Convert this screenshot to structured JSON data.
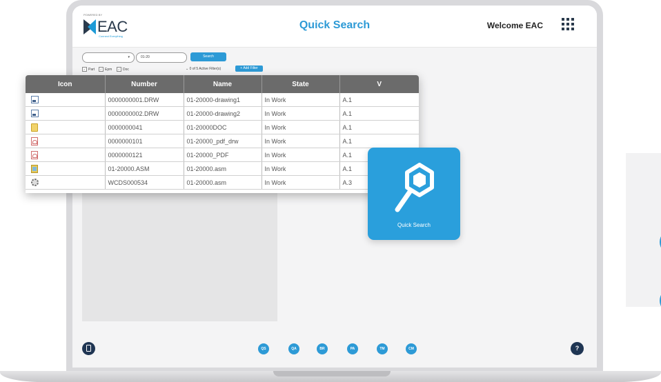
{
  "header": {
    "logo_text": "EAC",
    "logo_small": "POWERED BY",
    "logo_tagline": "Connect Everything",
    "title": "Quick Search",
    "welcome": "Welcome EAC",
    "menu_icon": "apps-grid-icon"
  },
  "search": {
    "select_value": "",
    "input_value": "01-20",
    "button_label": "Search",
    "filters": [
      {
        "label": "Part",
        "checked": true
      },
      {
        "label": "Epm",
        "checked": true
      },
      {
        "label": "Doc",
        "checked": true
      }
    ],
    "active_filters": "0 of 5 Active Filter(s)",
    "add_filter": "+ Add Filter"
  },
  "table": {
    "columns": [
      "Icon",
      "Number",
      "Name",
      "State",
      "V"
    ],
    "rows": [
      {
        "icon": "drawing-icon",
        "number": "0000000001.DRW",
        "name": "01-20000-drawing1",
        "state": "In Work",
        "version": "A.1"
      },
      {
        "icon": "drawing-icon",
        "number": "0000000002.DRW",
        "name": "01-20000-drawing2",
        "state": "In Work",
        "version": "A.1"
      },
      {
        "icon": "document-icon",
        "number": "0000000041",
        "name": "01-20000DOC",
        "state": "In Work",
        "version": "A.1"
      },
      {
        "icon": "pdf-icon",
        "number": "0000000101",
        "name": "01-20000_pdf_drw",
        "state": "In Work",
        "version": "A.1"
      },
      {
        "icon": "pdf-icon",
        "number": "0000000121",
        "name": "01-20000_PDF",
        "state": "In Work",
        "version": "A.1"
      },
      {
        "icon": "assembly-icon",
        "number": "01-20000.ASM",
        "name": "01-20000.asm",
        "state": "In Work",
        "version": "A.1"
      },
      {
        "icon": "gear-icon",
        "number": "WCDS000534",
        "name": "01-20000.asm",
        "state": "In Work",
        "version": "A.3"
      }
    ]
  },
  "tile": {
    "label": "Quick Search",
    "icon": "magnifier-hexagon-icon",
    "color": "#2a9fdc"
  },
  "bottom_nav": {
    "left_icon": "mobile-icon",
    "items": [
      "QS",
      "QA",
      "BR",
      "PA",
      "TM",
      "CM"
    ],
    "help_label": "?"
  },
  "colors": {
    "accent": "#2d9ad6",
    "dark": "#1f3553",
    "table_header": "#6b6b6b"
  }
}
